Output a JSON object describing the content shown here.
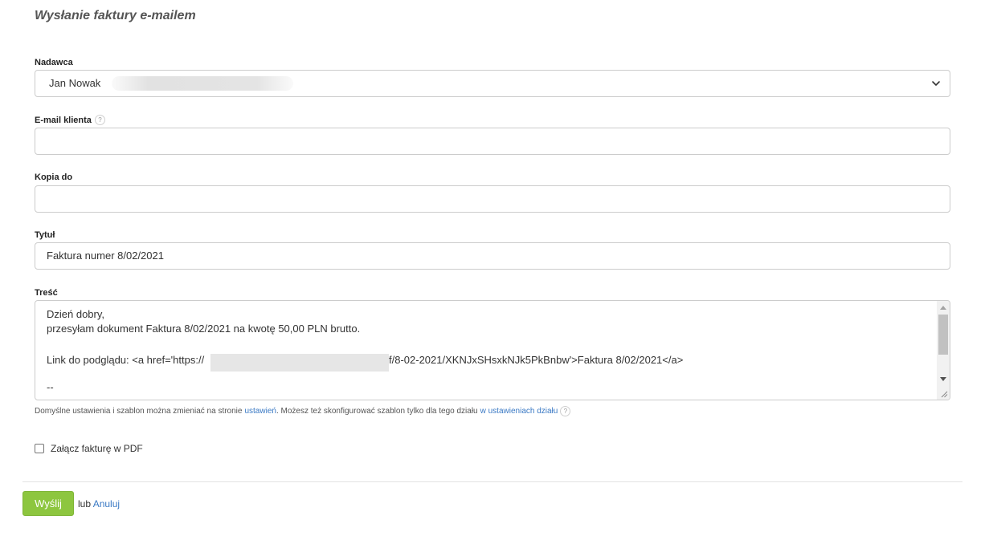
{
  "page": {
    "title": "Wysłanie faktury e-mailem"
  },
  "sender": {
    "label": "Nadawca",
    "selected_value": "Jan Nowak"
  },
  "client_email": {
    "label": "E-mail klienta",
    "help": "?",
    "value": ""
  },
  "cc": {
    "label": "Kopia do",
    "value": ""
  },
  "subject": {
    "label": "Tytuł",
    "value": "Faktura numer 8/02/2021"
  },
  "body": {
    "label": "Treść",
    "lines": [
      "Dzień dobry,",
      "przesyłam dokument Faktura 8/02/2021 na kwotę 50,00 PLN brutto.",
      "",
      "Link do podglądu: <a href='https://",
      "--"
    ],
    "link_tail": "f/8-02-2021/XKNJxSHsxkNJk5PkBnbw'>Faktura 8/02/2021</a>"
  },
  "hint": {
    "text_before": "Domyślne ustawienia i szablon można zmieniać na stronie",
    "settings_link": "ustawień",
    "text_middle": ". Możesz też skonfigurować szablon tylko dla tego działu",
    "dept_link": "w ustawieniach działu",
    "help": "?"
  },
  "attach_pdf": {
    "label": "Załącz fakturę w PDF",
    "checked": false
  },
  "actions": {
    "send_label": "Wyślij",
    "or_text": "lub",
    "cancel_label": "Anuluj"
  },
  "colors": {
    "accent_green": "#8dc63f",
    "link_blue": "#3a79c4"
  }
}
